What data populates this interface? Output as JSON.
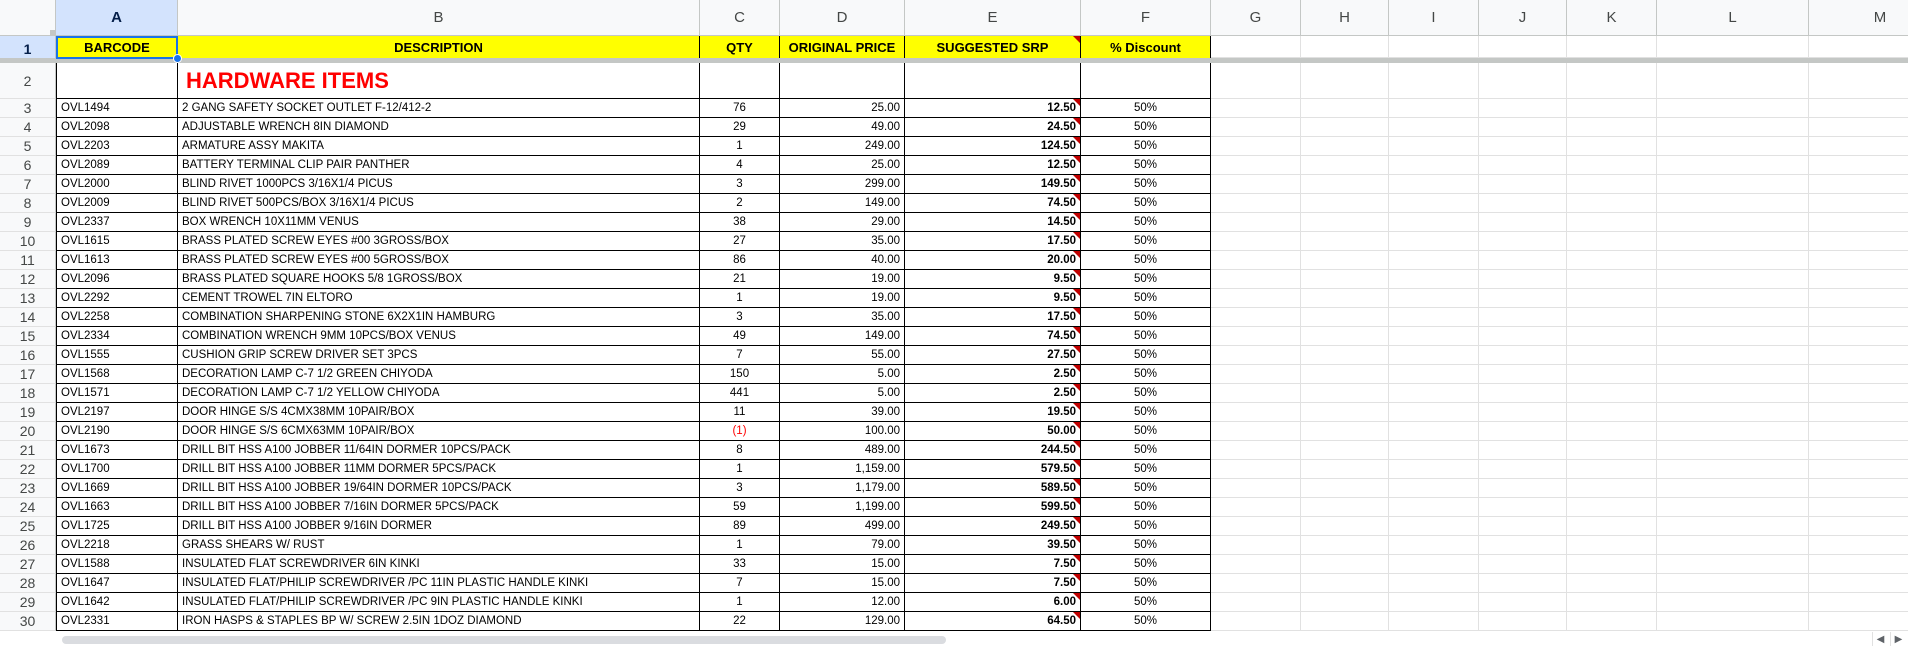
{
  "sheet": {
    "columns": [
      "A",
      "B",
      "C",
      "D",
      "E",
      "F",
      "G",
      "H",
      "I",
      "J",
      "K",
      "L",
      "M"
    ],
    "selected_column": "A",
    "selected_row": "1",
    "header_row": {
      "row_number": "1",
      "labels": [
        "BARCODE",
        "DESCRIPTION",
        "QTY",
        "ORIGINAL PRICE",
        "SUGGESTED SRP",
        "% Discount"
      ]
    },
    "section_row": {
      "row_number": "2",
      "title": "HARDWARE ITEMS"
    },
    "rows": [
      {
        "n": "3",
        "barcode": "OVL1494",
        "desc": "2 GANG SAFETY SOCKET OUTLET F-12/412-2",
        "qty": "76",
        "orig": "25.00",
        "srp": "12.50",
        "disc": "50%"
      },
      {
        "n": "4",
        "barcode": "OVL2098",
        "desc": "ADJUSTABLE WRENCH 8IN DIAMOND",
        "qty": "29",
        "orig": "49.00",
        "srp": "24.50",
        "disc": "50%"
      },
      {
        "n": "5",
        "barcode": "OVL2203",
        "desc": "ARMATURE ASSY MAKITA",
        "qty": "1",
        "orig": "249.00",
        "srp": "124.50",
        "disc": "50%"
      },
      {
        "n": "6",
        "barcode": "OVL2089",
        "desc": "BATTERY TERMINAL CLIP PAIR PANTHER",
        "qty": "4",
        "orig": "25.00",
        "srp": "12.50",
        "disc": "50%"
      },
      {
        "n": "7",
        "barcode": "OVL2000",
        "desc": "BLIND RIVET 1000PCS 3/16X1/4 PICUS",
        "qty": "3",
        "orig": "299.00",
        "srp": "149.50",
        "disc": "50%"
      },
      {
        "n": "8",
        "barcode": "OVL2009",
        "desc": "BLIND RIVET 500PCS/BOX 3/16X1/4 PICUS",
        "qty": "2",
        "orig": "149.00",
        "srp": "74.50",
        "disc": "50%"
      },
      {
        "n": "9",
        "barcode": "OVL2337",
        "desc": "BOX WRENCH 10X11MM VENUS",
        "qty": "38",
        "orig": "29.00",
        "srp": "14.50",
        "disc": "50%"
      },
      {
        "n": "10",
        "barcode": "OVL1615",
        "desc": "BRASS PLATED SCREW EYES #00 3GROSS/BOX",
        "qty": "27",
        "orig": "35.00",
        "srp": "17.50",
        "disc": "50%"
      },
      {
        "n": "11",
        "barcode": "OVL1613",
        "desc": "BRASS PLATED SCREW EYES #00 5GROSS/BOX",
        "qty": "86",
        "orig": "40.00",
        "srp": "20.00",
        "disc": "50%"
      },
      {
        "n": "12",
        "barcode": "OVL2096",
        "desc": "BRASS PLATED SQUARE HOOKS 5/8 1GROSS/BOX",
        "qty": "21",
        "orig": "19.00",
        "srp": "9.50",
        "disc": "50%"
      },
      {
        "n": "13",
        "barcode": "OVL2292",
        "desc": "CEMENT TROWEL 7IN ELTORO",
        "qty": "1",
        "orig": "19.00",
        "srp": "9.50",
        "disc": "50%"
      },
      {
        "n": "14",
        "barcode": "OVL2258",
        "desc": "COMBINATION SHARPENING STONE 6X2X1IN HAMBURG",
        "qty": "3",
        "orig": "35.00",
        "srp": "17.50",
        "disc": "50%"
      },
      {
        "n": "15",
        "barcode": "OVL2334",
        "desc": "COMBINATION WRENCH 9MM 10PCS/BOX VENUS",
        "qty": "49",
        "orig": "149.00",
        "srp": "74.50",
        "disc": "50%"
      },
      {
        "n": "16",
        "barcode": "OVL1555",
        "desc": "CUSHION GRIP SCREW DRIVER SET 3PCS",
        "qty": "7",
        "orig": "55.00",
        "srp": "27.50",
        "disc": "50%"
      },
      {
        "n": "17",
        "barcode": "OVL1568",
        "desc": "DECORATION LAMP C-7 1/2 GREEN CHIYODA",
        "qty": "150",
        "orig": "5.00",
        "srp": "2.50",
        "disc": "50%"
      },
      {
        "n": "18",
        "barcode": "OVL1571",
        "desc": "DECORATION LAMP C-7 1/2 YELLOW CHIYODA",
        "qty": "441",
        "orig": "5.00",
        "srp": "2.50",
        "disc": "50%"
      },
      {
        "n": "19",
        "barcode": "OVL2197",
        "desc": "DOOR HINGE S/S 4CMX38MM 10PAIR/BOX",
        "qty": "11",
        "orig": "39.00",
        "srp": "19.50",
        "disc": "50%"
      },
      {
        "n": "20",
        "barcode": "OVL2190",
        "desc": "DOOR HINGE S/S 6CMX63MM 10PAIR/BOX",
        "qty": "(1)",
        "orig": "100.00",
        "srp": "50.00",
        "disc": "50%"
      },
      {
        "n": "21",
        "barcode": "OVL1673",
        "desc": "DRILL BIT HSS A100 JOBBER 11/64IN DORMER 10PCS/PACK",
        "qty": "8",
        "orig": "489.00",
        "srp": "244.50",
        "disc": "50%"
      },
      {
        "n": "22",
        "barcode": "OVL1700",
        "desc": "DRILL BIT HSS A100 JOBBER 11MM DORMER 5PCS/PACK",
        "qty": "1",
        "orig": "1,159.00",
        "srp": "579.50",
        "disc": "50%"
      },
      {
        "n": "23",
        "barcode": "OVL1669",
        "desc": "DRILL BIT HSS A100 JOBBER 19/64IN DORMER 10PCS/PACK",
        "qty": "3",
        "orig": "1,179.00",
        "srp": "589.50",
        "disc": "50%"
      },
      {
        "n": "24",
        "barcode": "OVL1663",
        "desc": "DRILL BIT HSS A100 JOBBER 7/16IN DORMER 5PCS/PACK",
        "qty": "59",
        "orig": "1,199.00",
        "srp": "599.50",
        "disc": "50%"
      },
      {
        "n": "25",
        "barcode": "OVL1725",
        "desc": "DRILL BIT HSS A100 JOBBER 9/16IN DORMER",
        "qty": "89",
        "orig": "499.00",
        "srp": "249.50",
        "disc": "50%"
      },
      {
        "n": "26",
        "barcode": "OVL2218",
        "desc": "GRASS SHEARS W/ RUST",
        "qty": "1",
        "orig": "79.00",
        "srp": "39.50",
        "disc": "50%"
      },
      {
        "n": "27",
        "barcode": "OVL1588",
        "desc": "INSULATED FLAT SCREWDRIVER 6IN KINKI",
        "qty": "33",
        "orig": "15.00",
        "srp": "7.50",
        "disc": "50%"
      },
      {
        "n": "28",
        "barcode": "OVL1647",
        "desc": "INSULATED FLAT/PHILIP SCREWDRIVER /PC 11IN PLASTIC HANDLE KINKI",
        "qty": "7",
        "orig": "15.00",
        "srp": "7.50",
        "disc": "50%"
      },
      {
        "n": "29",
        "barcode": "OVL1642",
        "desc": "INSULATED FLAT/PHILIP SCREWDRIVER /PC 9IN PLASTIC HANDLE KINKI",
        "qty": "1",
        "orig": "12.00",
        "srp": "6.00",
        "disc": "50%"
      },
      {
        "n": "30",
        "barcode": "OVL2331",
        "desc": "IRON HASPS & STAPLES BP W/ SCREW 2.5IN 1DOZ DIAMOND",
        "qty": "22",
        "orig": "129.00",
        "srp": "64.50",
        "disc": "50%"
      }
    ]
  },
  "scroll": {
    "left_icon": "chevron-left-icon",
    "right_icon": "chevron-right-icon"
  },
  "colors": {
    "header_fill": "#ffff00",
    "section_title": "#ff0000",
    "negative": "#ff0000",
    "selection": "#1a73e8"
  }
}
